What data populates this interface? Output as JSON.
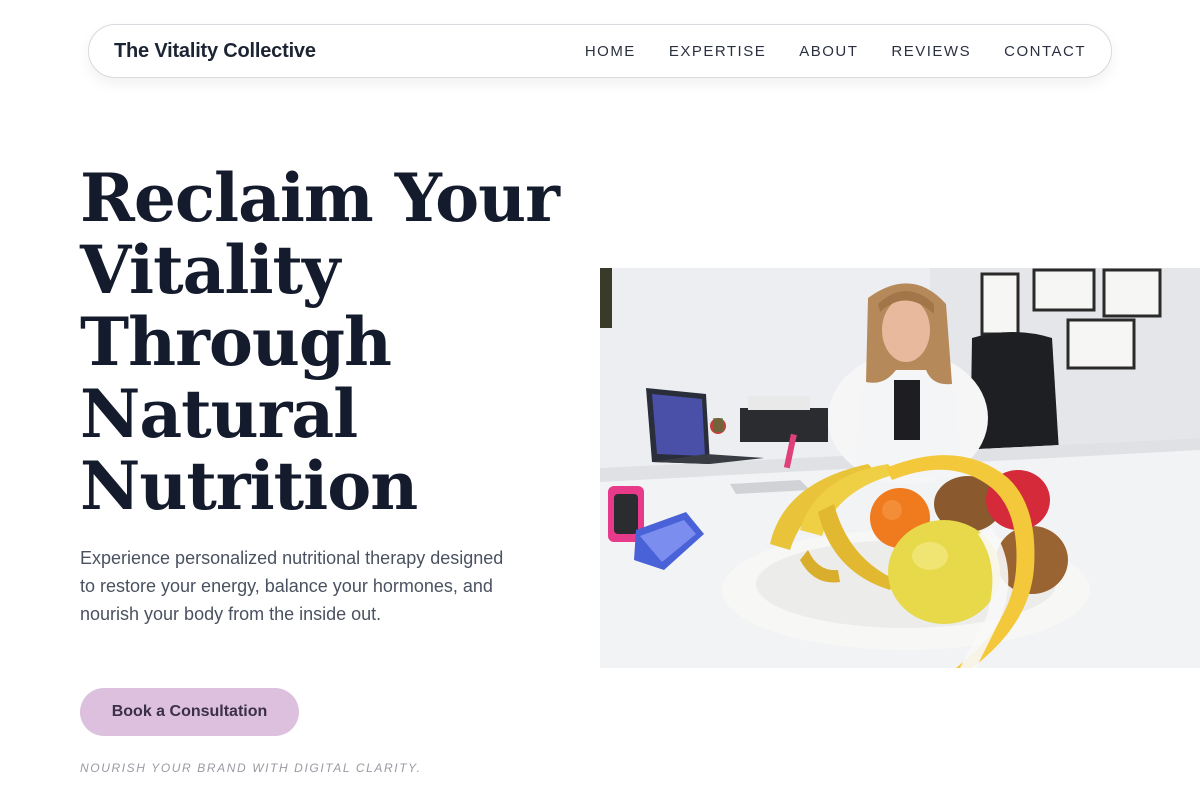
{
  "brand": {
    "name": "The Vitality Collective"
  },
  "nav": {
    "items": [
      {
        "label": "HOME"
      },
      {
        "label": "EXPERTISE"
      },
      {
        "label": "ABOUT"
      },
      {
        "label": "REVIEWS"
      },
      {
        "label": "CONTACT"
      }
    ]
  },
  "hero": {
    "title_lines": [
      "Reclaim Your",
      "Vitality",
      "Through",
      "Natural",
      "Nutrition"
    ],
    "body": "Experience personalized nutritional therapy designed to restore your energy, balance your hormones, and nourish your body from the inside out.",
    "cta_label": "Book a Consultation",
    "tagline": "NOURISH YOUR BRAND WITH DIGITAL CLARITY."
  },
  "colors": {
    "accent": "#dcc0dd",
    "heading": "#141b2d",
    "body_text": "#4a5160"
  }
}
